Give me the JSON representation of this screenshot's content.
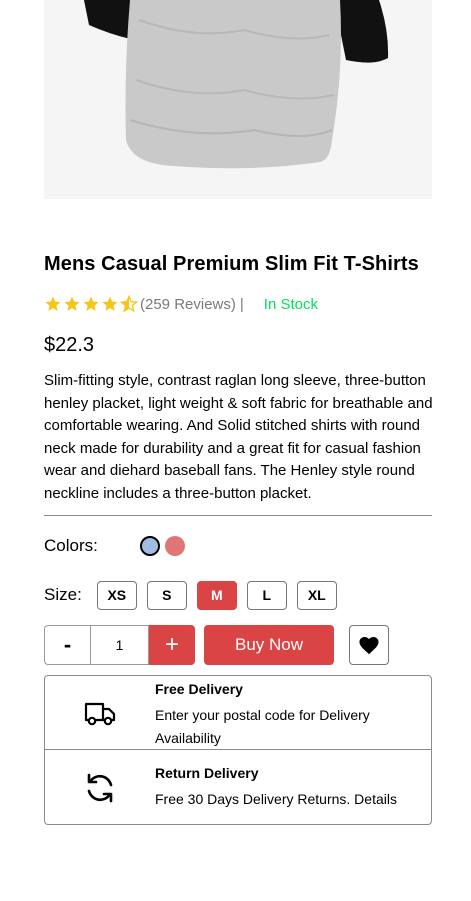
{
  "product": {
    "title": "Mens Casual Premium Slim Fit T-Shirts",
    "rating": 4.5,
    "reviews": "(259 Reviews)",
    "separator": "|",
    "stock": "In Stock",
    "price": "$22.3",
    "description": "Slim-fitting style, contrast raglan long sleeve, three-button henley placket, light weight & soft fabric for breathable and comfortable wearing. And Solid stitched shirts with round neck made for durability and a great fit for casual fashion wear and diehard baseball fans. The Henley style round neckline includes a three-button placket."
  },
  "colors": {
    "label": "Colors:",
    "options": [
      "#a0bce0",
      "#e07575"
    ]
  },
  "size": {
    "label": "Size:",
    "options": [
      "XS",
      "S",
      "M",
      "L",
      "XL"
    ],
    "selected": "M"
  },
  "quantity": {
    "minus": "-",
    "value": "1",
    "plus": "+"
  },
  "buy_label": "Buy Now",
  "delivery": {
    "free_title": "Free Delivery",
    "free_text": "Enter your postal code for Delivery Availability",
    "return_title": "Return Delivery",
    "return_text": "Free 30 Days Delivery Returns. Details"
  },
  "accent_color": "#db4444",
  "stock_color": "#00e05a"
}
